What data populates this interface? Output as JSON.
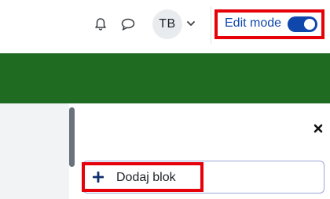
{
  "header": {
    "icons": {
      "notifications": "bell-icon",
      "messages": "chat-bubble-icon",
      "user_menu_caret": "chevron-down-icon"
    },
    "user": {
      "initials": "TB"
    },
    "edit_mode": {
      "label": "Edit mode",
      "enabled": true
    }
  },
  "colors": {
    "banner": "#1f6b22",
    "accent": "#0f47ad",
    "highlight": "#e6000a"
  },
  "content": {
    "close_icon": "close-icon",
    "add_block": {
      "label": "Dodaj blok",
      "icon": "plus-icon"
    }
  }
}
